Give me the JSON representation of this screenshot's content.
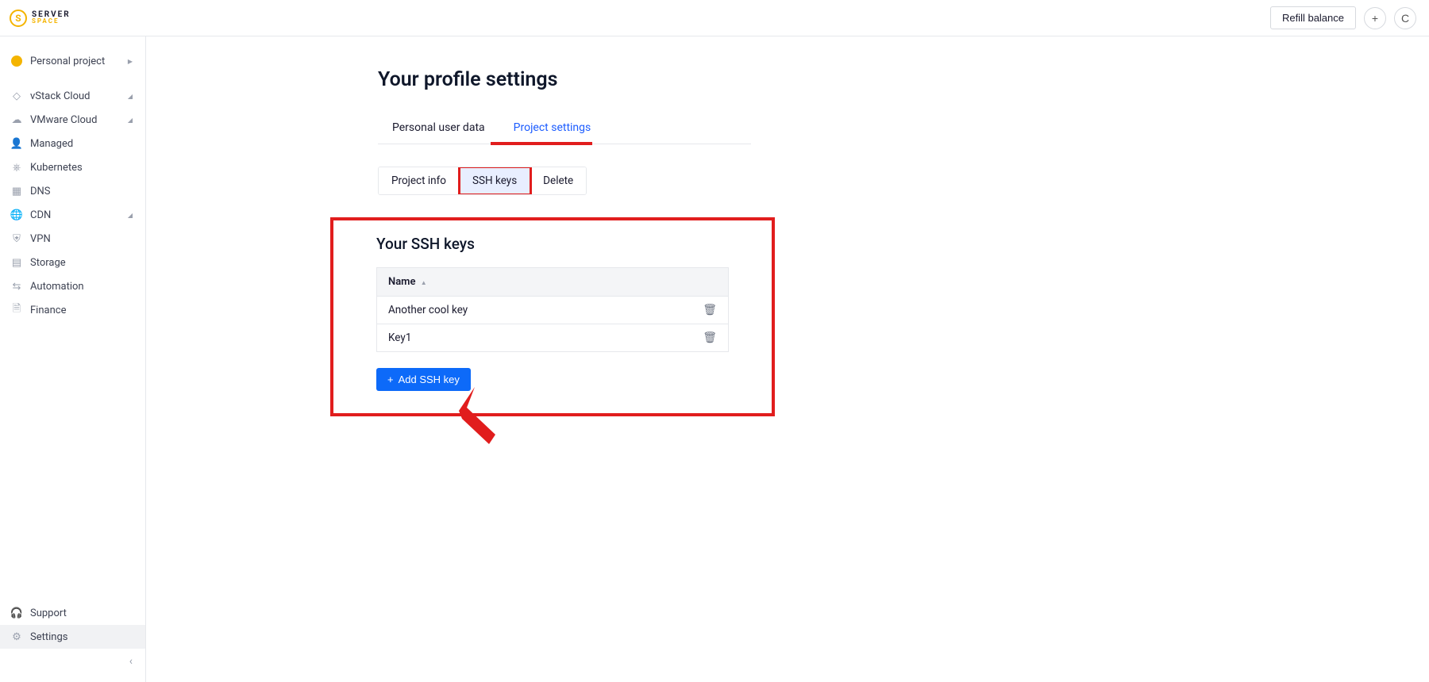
{
  "brand": {
    "top": "SERVER",
    "bottom": "SPACE",
    "mark": "S"
  },
  "header": {
    "refill": "Refill balance",
    "plus": "+",
    "avatar_initial": "C"
  },
  "sidebar": {
    "project": {
      "label": "Personal project"
    },
    "items": [
      {
        "icon": "cloud-alt",
        "label": "vStack Cloud",
        "expandable": true
      },
      {
        "icon": "cloud",
        "label": "VMware Cloud",
        "expandable": true
      },
      {
        "icon": "person",
        "label": "Managed",
        "expandable": false
      },
      {
        "icon": "gear",
        "label": "Kubernetes",
        "expandable": false
      },
      {
        "icon": "doc",
        "label": "DNS",
        "expandable": false
      },
      {
        "icon": "globe",
        "label": "CDN",
        "expandable": true
      },
      {
        "icon": "shield",
        "label": "VPN",
        "expandable": false
      },
      {
        "icon": "db",
        "label": "Storage",
        "expandable": false
      },
      {
        "icon": "swap",
        "label": "Automation",
        "expandable": false
      },
      {
        "icon": "file",
        "label": "Finance",
        "expandable": false
      }
    ],
    "footer": [
      {
        "icon": "headset",
        "label": "Support"
      },
      {
        "icon": "cog",
        "label": "Settings",
        "active": true
      }
    ]
  },
  "page": {
    "title": "Your profile settings",
    "tabs": [
      {
        "label": "Personal user data",
        "active": false
      },
      {
        "label": "Project settings",
        "active": true
      }
    ],
    "subtabs": [
      {
        "label": "Project info",
        "active": false
      },
      {
        "label": "SSH keys",
        "active": true
      },
      {
        "label": "Delete",
        "active": false
      }
    ],
    "panel_title": "Your SSH keys",
    "table": {
      "header": "Name",
      "rows": [
        {
          "name": "Another cool key"
        },
        {
          "name": "Key1"
        }
      ]
    },
    "add_btn": "Add SSH key"
  }
}
